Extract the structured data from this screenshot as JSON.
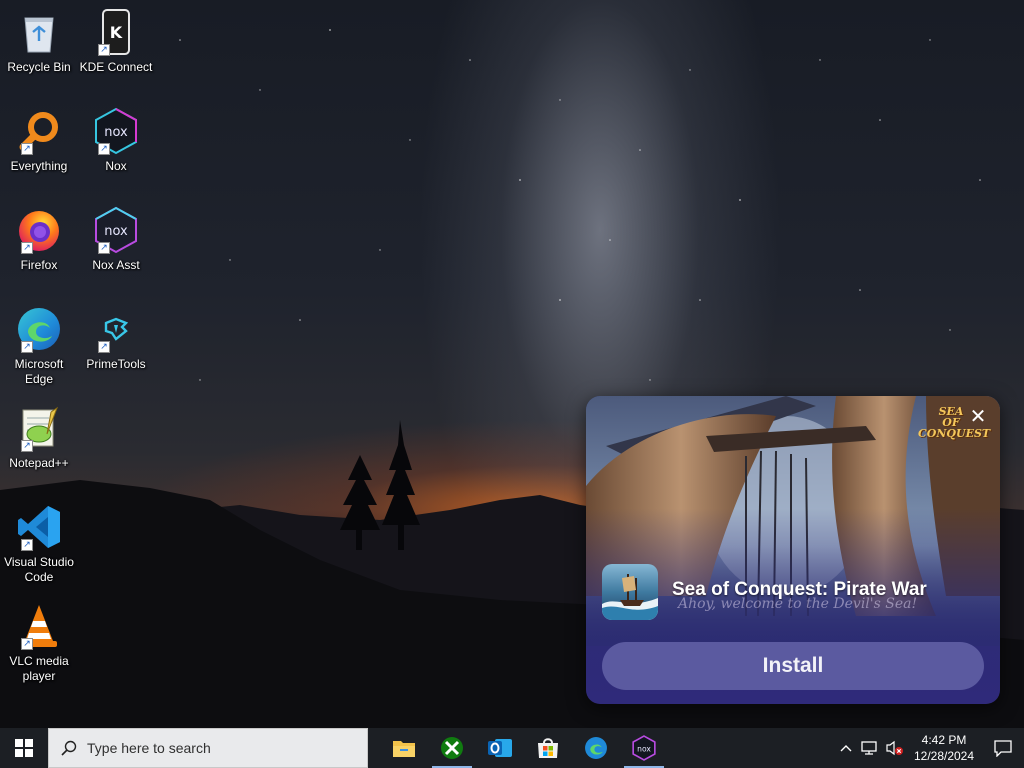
{
  "desktop": {
    "icons": [
      {
        "id": "recycle-bin",
        "label": "Recycle Bin",
        "icon": "recycle-bin-icon"
      },
      {
        "id": "kde-connect",
        "label": "KDE Connect",
        "icon": "kde-connect-icon"
      },
      {
        "id": "everything",
        "label": "Everything",
        "icon": "magnifier-icon"
      },
      {
        "id": "nox",
        "label": "Nox",
        "icon": "nox-icon"
      },
      {
        "id": "firefox",
        "label": "Firefox",
        "icon": "firefox-icon"
      },
      {
        "id": "nox-asst",
        "label": "Nox Asst",
        "icon": "nox-asst-icon"
      },
      {
        "id": "edge",
        "label": "Microsoft\nEdge",
        "icon": "edge-icon"
      },
      {
        "id": "primetools",
        "label": "PrimeTools",
        "icon": "primetools-icon"
      },
      {
        "id": "notepadpp",
        "label": "Notepad++",
        "icon": "notepadpp-icon"
      },
      {
        "id": "vscode",
        "label": "Visual Studio\nCode",
        "icon": "vscode-icon"
      },
      {
        "id": "vlc",
        "label": "VLC media\nplayer",
        "icon": "vlc-icon"
      }
    ]
  },
  "ad": {
    "logo_line1": "SEA",
    "logo_line2": "OF CONQUEST",
    "close_symbol": "✕",
    "title": "Sea of Conquest: Pirate War",
    "subtitle": "Ahoy, welcome to the Devil's Sea!",
    "install_label": "Install"
  },
  "taskbar": {
    "search_placeholder": "Type here to search",
    "pinned": [
      "file-explorer-icon",
      "xbox-icon",
      "outlook-icon",
      "microsoft-store-icon",
      "edge-icon",
      "nox-icon"
    ],
    "clock_time": "4:42 PM",
    "clock_date": "12/28/2024"
  },
  "colors": {
    "taskbar": "#1c1f24",
    "ad_background": "#2c2c73",
    "install_button": "#5b5aa0",
    "active_underline": "#8fb6e8"
  }
}
